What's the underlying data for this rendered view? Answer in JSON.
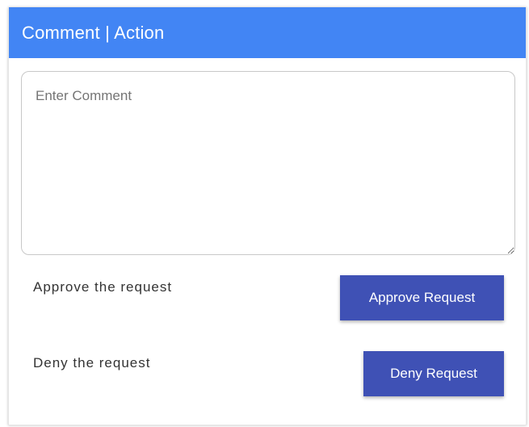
{
  "header": {
    "title": "Comment | Action"
  },
  "comment": {
    "placeholder": "Enter Comment",
    "value": ""
  },
  "actions": {
    "approve_label": "Approve the request",
    "approve_button": "Approve Request",
    "deny_label": "Deny the request",
    "deny_button": "Deny Request"
  },
  "colors": {
    "header_bg": "#4285f4",
    "button_bg": "#3f51b5"
  }
}
